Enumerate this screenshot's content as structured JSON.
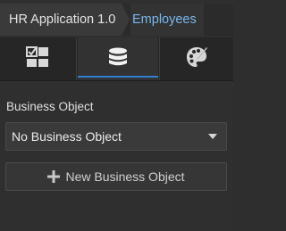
{
  "breadcrumb": {
    "app": "HR Application 1.0",
    "current": "Employees"
  },
  "tabs": [
    {
      "icon": "components-icon",
      "active": false
    },
    {
      "icon": "database-icon",
      "active": true
    },
    {
      "icon": "palette-icon",
      "active": false
    }
  ],
  "colors": {
    "accent": "#2f7fd1",
    "breadcrumb_current": "#79b7ef",
    "background": "#2f2f2f"
  },
  "business_object": {
    "label": "Business Object",
    "selected": "No Business Object",
    "new_button_label": "New Business Object",
    "new_button_icon": "plus-icon"
  }
}
